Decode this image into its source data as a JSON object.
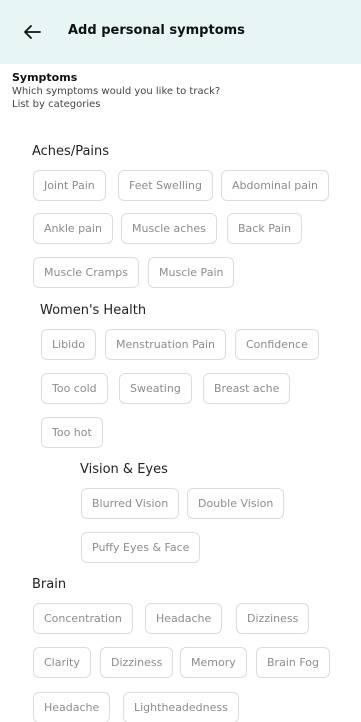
{
  "header": {
    "title": "Add personal symptoms"
  },
  "intro": {
    "heading": "Symptoms",
    "question": "Which symptoms would you like to track?",
    "hint": "List by categories"
  },
  "categories": {
    "aches": {
      "label": "Aches/Pains",
      "chips": [
        "Joint Pain",
        "Feet Swelling",
        "Abdominal pain",
        "Ankle pain",
        "Muscle aches",
        "Back Pain",
        "Muscle Cramps",
        "Muscle Pain"
      ]
    },
    "women": {
      "label": "Women's Health",
      "chips": [
        "Libido",
        "Menstruation Pain",
        "Confidence",
        "Too cold",
        "Sweating",
        "Breast ache",
        "Too hot"
      ]
    },
    "vision": {
      "label": "Vision & Eyes",
      "chips": [
        "Blurred Vision",
        "Double Vision",
        "Puffy Eyes & Face"
      ]
    },
    "brain": {
      "label": "Brain",
      "chips": [
        "Concentration",
        "Headache",
        "Dizziness",
        "Clarity",
        "Dizziness",
        "Memory",
        "Brain Fog",
        "Headache",
        "Lightheadedness"
      ]
    }
  }
}
